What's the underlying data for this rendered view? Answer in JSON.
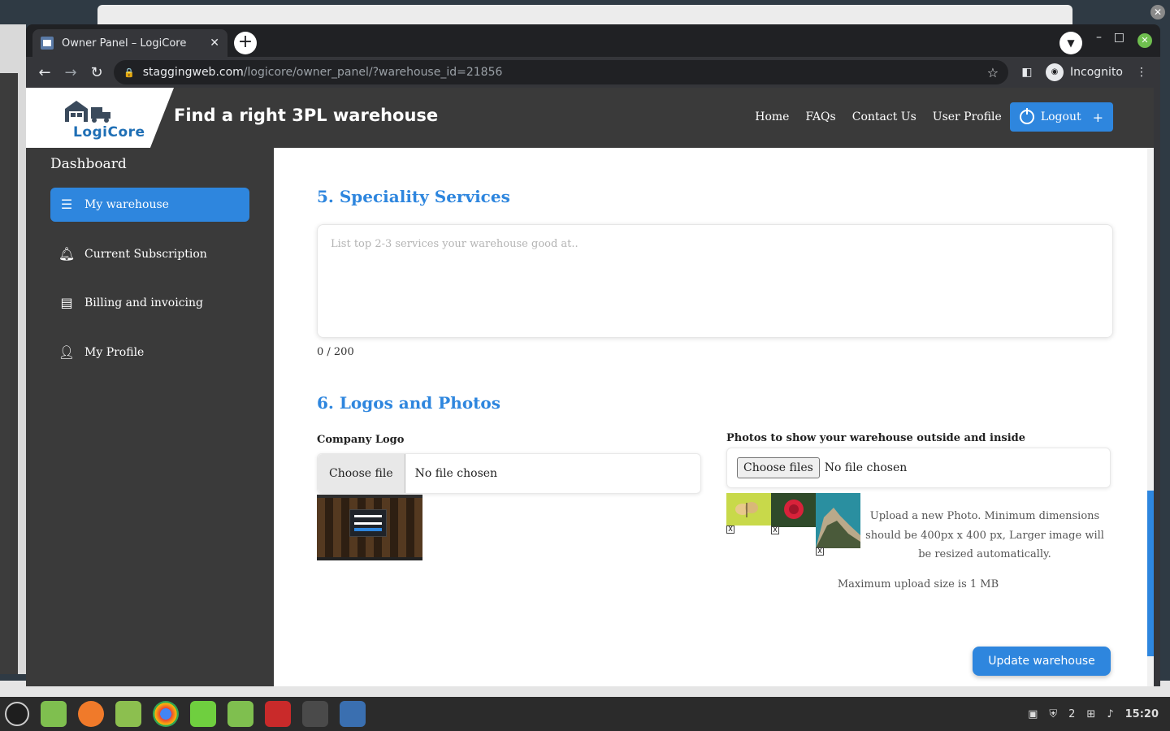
{
  "browser": {
    "tab_title": "Owner Panel – LogiCore",
    "url_host": "staggingweb.com",
    "url_path": "/logicore/owner_panel/?warehouse_id=21856",
    "incognito_label": "Incognito"
  },
  "header": {
    "brand": "LogiCore",
    "tagline": "Find a right 3PL warehouse",
    "nav": [
      "Home",
      "FAQs",
      "Contact Us",
      "User Profile"
    ],
    "logout_label": "Logout"
  },
  "sidebar": {
    "title": "Dashboard",
    "items": [
      {
        "label": "My warehouse",
        "icon": "list-icon",
        "active": true
      },
      {
        "label": "Current Subscription",
        "icon": "bell-icon",
        "active": false
      },
      {
        "label": "Billing and invoicing",
        "icon": "receipt-icon",
        "active": false
      },
      {
        "label": "My Profile",
        "icon": "user-icon",
        "active": false
      }
    ]
  },
  "main": {
    "section5_title": "5. Speciality Services",
    "services_placeholder": "List top 2-3 services your warehouse good at..",
    "services_counter": "0 / 200",
    "section6_title": "6. Logos and Photos",
    "company_logo_label": "Company Logo",
    "company_logo_button": "Choose file",
    "company_logo_status": "No file chosen",
    "photos_label": "Photos to show your warehouse outside and inside",
    "photos_button": "Choose files",
    "photos_status": "No file chosen",
    "photo_remove_glyph": "X",
    "upload_note": "Upload a new Photo. Minimum dimensions should be 400px x 400 px, Larger image will be resized automatically.",
    "max_note": "Maximum upload size is 1 MB",
    "update_button": "Update warehouse"
  },
  "system": {
    "clock": "15:20",
    "tray_badge": "2"
  },
  "colors": {
    "accent": "#2e86de",
    "header_bg": "#3a3a3a",
    "section_title": "#2e86de"
  }
}
